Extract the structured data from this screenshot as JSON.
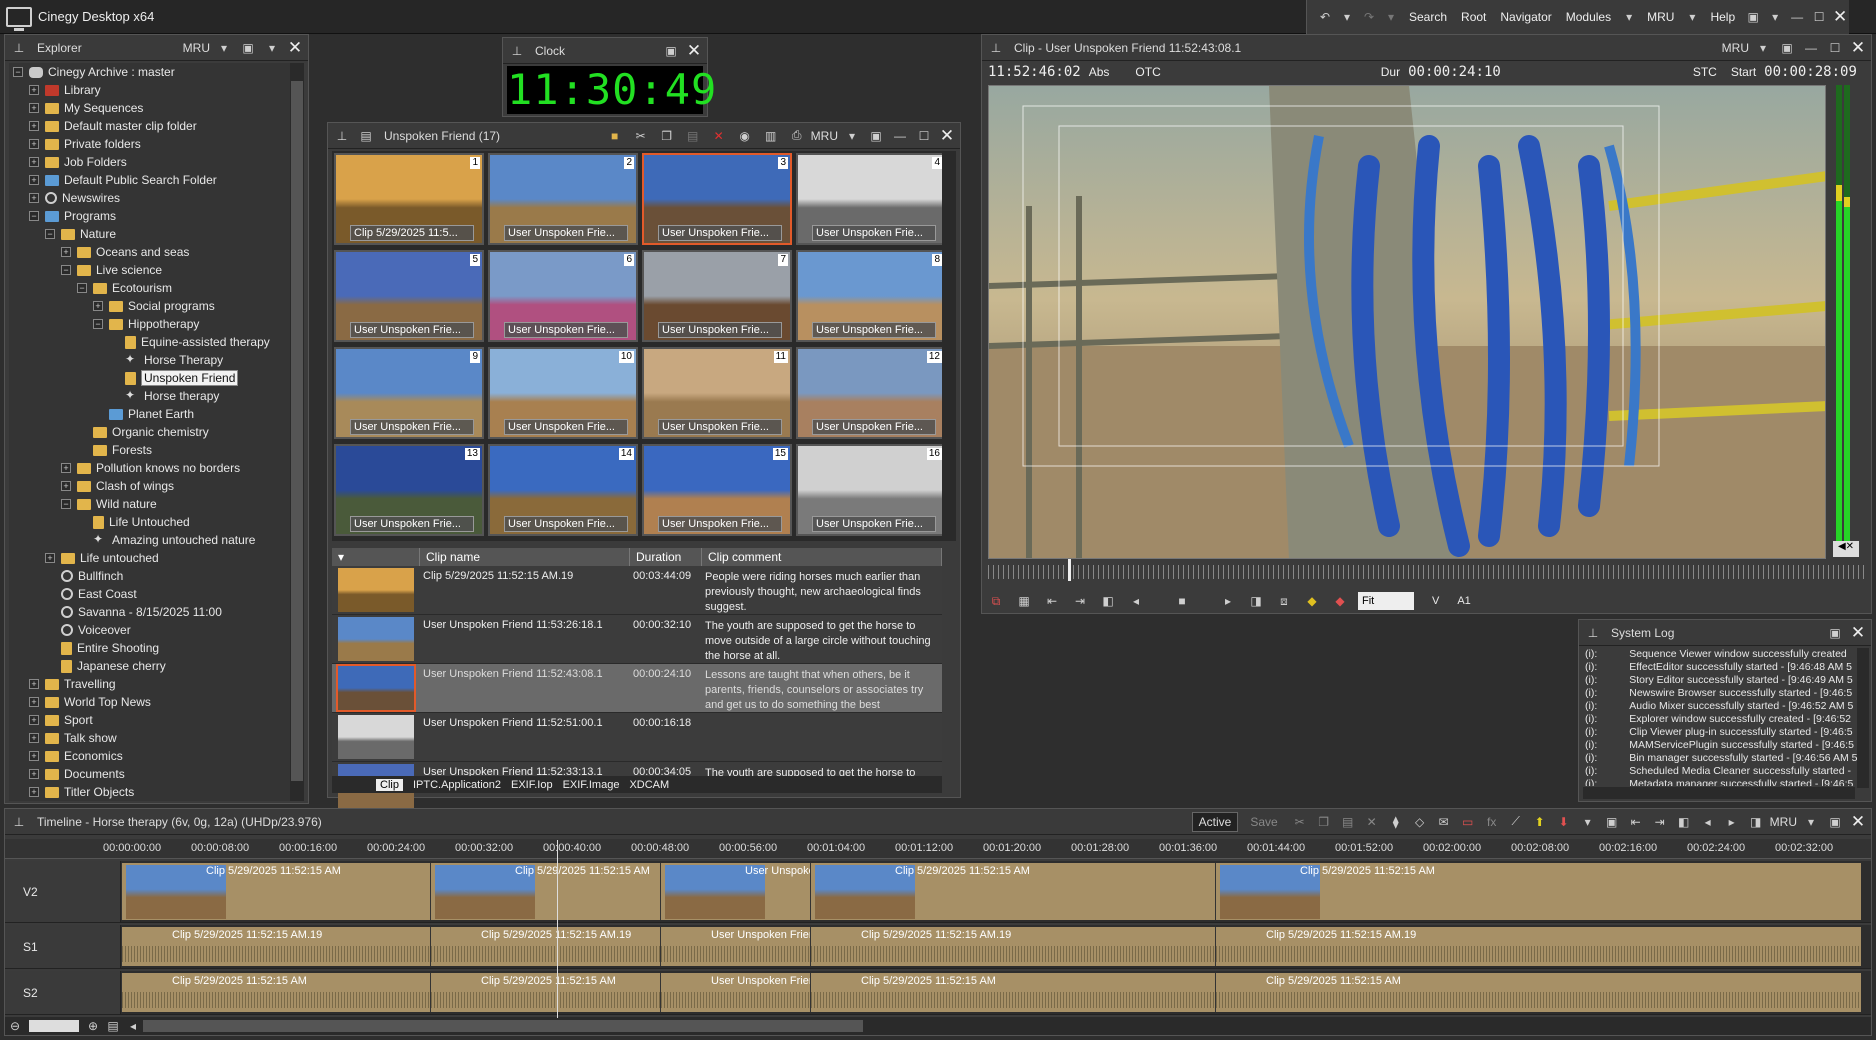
{
  "app": {
    "title": "Cinegy Desktop x64"
  },
  "menu": {
    "items": [
      "Search",
      "Root",
      "Navigator",
      "Modules",
      "MRU",
      "Help"
    ]
  },
  "explorer": {
    "title": "Explorer",
    "mru": "MRU",
    "tree": [
      {
        "label": "Cinegy Archive : master",
        "indent": 0,
        "pm": "-",
        "icon": "db"
      },
      {
        "label": "Library",
        "indent": 1,
        "pm": "+",
        "icon": "red"
      },
      {
        "label": "My Sequences",
        "indent": 1,
        "pm": "+",
        "icon": "folder"
      },
      {
        "label": "Default master clip folder",
        "indent": 1,
        "pm": "+",
        "icon": "folder"
      },
      {
        "label": "Private folders",
        "indent": 1,
        "pm": "+",
        "icon": "folder"
      },
      {
        "label": "Job Folders",
        "indent": 1,
        "pm": "+",
        "icon": "folder"
      },
      {
        "label": "Default Public Search Folder",
        "indent": 1,
        "pm": "+",
        "icon": "blue"
      },
      {
        "label": "Newswires",
        "indent": 1,
        "pm": "+",
        "icon": "glb"
      },
      {
        "label": "Programs",
        "indent": 1,
        "pm": "-",
        "icon": "blue"
      },
      {
        "label": "Nature",
        "indent": 2,
        "pm": "-",
        "icon": "folder"
      },
      {
        "label": "Oceans and seas",
        "indent": 3,
        "pm": "+",
        "icon": "folder"
      },
      {
        "label": "Live science",
        "indent": 3,
        "pm": "-",
        "icon": "folder"
      },
      {
        "label": "Ecotourism",
        "indent": 4,
        "pm": "-",
        "icon": "folder"
      },
      {
        "label": "Social programs",
        "indent": 5,
        "pm": "+",
        "icon": "folder"
      },
      {
        "label": "Hippotherapy",
        "indent": 5,
        "pm": "-",
        "icon": "folder"
      },
      {
        "label": "Equine-assisted therapy",
        "indent": 6,
        "pm": "",
        "icon": "doc"
      },
      {
        "label": "Horse Therapy",
        "indent": 6,
        "pm": "",
        "icon": "star"
      },
      {
        "label": "Unspoken Friend",
        "indent": 6,
        "pm": "",
        "icon": "doc",
        "selected": true
      },
      {
        "label": "Horse therapy",
        "indent": 6,
        "pm": "",
        "icon": "star"
      },
      {
        "label": "Planet Earth",
        "indent": 5,
        "pm": "",
        "icon": "blue"
      },
      {
        "label": "Organic chemistry",
        "indent": 4,
        "pm": "",
        "icon": "folder"
      },
      {
        "label": "Forests",
        "indent": 4,
        "pm": "",
        "icon": "folder"
      },
      {
        "label": "Pollution knows no borders",
        "indent": 3,
        "pm": "+",
        "icon": "folder"
      },
      {
        "label": "Clash of wings",
        "indent": 3,
        "pm": "+",
        "icon": "folder"
      },
      {
        "label": "Wild nature",
        "indent": 3,
        "pm": "-",
        "icon": "folder"
      },
      {
        "label": "Life Untouched",
        "indent": 4,
        "pm": "",
        "icon": "doc"
      },
      {
        "label": "Amazing untouched nature",
        "indent": 4,
        "pm": "",
        "icon": "star"
      },
      {
        "label": "Life untouched",
        "indent": 2,
        "pm": "+",
        "icon": "folder"
      },
      {
        "label": "Bullfinch",
        "indent": 2,
        "pm": "",
        "icon": "glb"
      },
      {
        "label": "East Coast",
        "indent": 2,
        "pm": "",
        "icon": "glb"
      },
      {
        "label": "Savanna - 8/15/2025 11:00",
        "indent": 2,
        "pm": "",
        "icon": "glb"
      },
      {
        "label": "Voiceover",
        "indent": 2,
        "pm": "",
        "icon": "glb"
      },
      {
        "label": "Entire Shooting",
        "indent": 2,
        "pm": "",
        "icon": "doc"
      },
      {
        "label": "Japanese cherry",
        "indent": 2,
        "pm": "",
        "icon": "doc"
      },
      {
        "label": "Travelling",
        "indent": 1,
        "pm": "+",
        "icon": "folder"
      },
      {
        "label": "World Top News",
        "indent": 1,
        "pm": "+",
        "icon": "folder"
      },
      {
        "label": "Sport",
        "indent": 1,
        "pm": "+",
        "icon": "folder"
      },
      {
        "label": "Talk show",
        "indent": 1,
        "pm": "+",
        "icon": "folder"
      },
      {
        "label": "Economics",
        "indent": 1,
        "pm": "+",
        "icon": "folder"
      },
      {
        "label": "Documents",
        "indent": 1,
        "pm": "+",
        "icon": "folder"
      },
      {
        "label": "Titler Objects",
        "indent": 1,
        "pm": "+",
        "icon": "folder"
      }
    ]
  },
  "clock": {
    "title": "Clock",
    "time": "11:30:49"
  },
  "bin": {
    "title": "Unspoken Friend (17)",
    "mru": "MRU",
    "thumbs": [
      {
        "n": "1",
        "cap": "Clip 5/29/2025 11:5...",
        "sky": "#d9a24a",
        "ground": "#7a5a2a"
      },
      {
        "n": "2",
        "cap": "User Unspoken Frie...",
        "sky": "#5a88c8",
        "ground": "#9a7a4a"
      },
      {
        "n": "3",
        "cap": "User Unspoken Frie...",
        "sky": "#3e6ab8",
        "ground": "#6a5038",
        "selected": true
      },
      {
        "n": "4",
        "cap": "User Unspoken Frie...",
        "sky": "#d8d8d8",
        "ground": "#6a6a6a"
      },
      {
        "n": "5",
        "cap": "User Unspoken Frie...",
        "sky": "#4a6ab8",
        "ground": "#8a6a44"
      },
      {
        "n": "6",
        "cap": "User Unspoken Frie...",
        "sky": "#7a9ac8",
        "ground": "#b05080"
      },
      {
        "n": "7",
        "cap": "User Unspoken Frie...",
        "sky": "#9aa0a8",
        "ground": "#6a4a30"
      },
      {
        "n": "8",
        "cap": "User Unspoken Frie...",
        "sky": "#6a98d0",
        "ground": "#b89060"
      },
      {
        "n": "9",
        "cap": "User Unspoken Frie...",
        "sky": "#5a88c8",
        "ground": "#a88a5a"
      },
      {
        "n": "10",
        "cap": "User Unspoken Frie...",
        "sky": "#8ab0d8",
        "ground": "#a88050"
      },
      {
        "n": "11",
        "cap": "User Unspoken Frie...",
        "sky": "#c8a880",
        "ground": "#9a7a50"
      },
      {
        "n": "12",
        "cap": "User Unspoken Frie...",
        "sky": "#7a98c0",
        "ground": "#a88060"
      },
      {
        "n": "13",
        "cap": "User Unspoken Frie...",
        "sky": "#2a4a98",
        "ground": "#4a5a3a"
      },
      {
        "n": "14",
        "cap": "User Unspoken Frie...",
        "sky": "#3a6ac0",
        "ground": "#8a6a3a"
      },
      {
        "n": "15",
        "cap": "User Unspoken Frie...",
        "sky": "#3a68c0",
        "ground": "#b08050"
      },
      {
        "n": "16",
        "cap": "User Unspoken Frie...",
        "sky": "#d0d0d0",
        "ground": "#7a7a7a"
      }
    ],
    "columns": [
      "Clip name",
      "Duration",
      "Clip comment"
    ],
    "rows": [
      {
        "name": "Clip 5/29/2025 11:52:15 AM.19",
        "dur": "00:03:44:09",
        "comment": "People were riding horses much earlier than previously thought, new archaeological finds suggest.",
        "sky": "#d9a24a",
        "ground": "#7a5a2a"
      },
      {
        "name": "User Unspoken Friend 11:53:26:18.1",
        "dur": "00:00:32:10",
        "comment": "The youth are supposed to get the horse to move outside of a large circle without touching the horse at all.",
        "sky": "#5a88c8",
        "ground": "#9a7a4a"
      },
      {
        "name": "User Unspoken Friend 11:52:43:08.1",
        "dur": "00:00:24:10",
        "comment": "Lessons are taught that when others, be it parents, friends, counselors or associates try and get us to do something the best",
        "sky": "#3e6ab8",
        "ground": "#6a5038",
        "selected": true
      },
      {
        "name": "User Unspoken Friend 11:52:51:00.1",
        "dur": "00:00:16:18",
        "comment": "",
        "sky": "#d8d8d8",
        "ground": "#6a6a6a"
      },
      {
        "name": "User Unspoken Friend 11:52:33:13.1",
        "dur": "00:00:34:05",
        "comment": "The youth are supposed to get the horse to",
        "sky": "#4a6ab8",
        "ground": "#8a6a44"
      }
    ],
    "tabs": [
      "Clip",
      "IPTC.Application2",
      "EXIF.Iop",
      "EXIF.Image",
      "XDCAM"
    ]
  },
  "viewer": {
    "title": "Clip - User Unspoken Friend 11:52:43:08.1",
    "mru": "MRU",
    "tc": "11:52:46:02",
    "abs": "Abs",
    "otc": "OTC",
    "dur_label": "Dur",
    "dur": "00:00:24:10",
    "stc": "STC",
    "start_label": "Start",
    "start": "00:00:28:09",
    "fit": "Fit",
    "v": "V",
    "a1": "A1"
  },
  "syslog": {
    "title": "System Log",
    "lines": [
      "Sequence Viewer window successfully created",
      "EffectEditor successfully started - [9:46:48 AM 5",
      "Story Editor successfully started - [9:46:49 AM 5",
      "Newswire Browser successfully started - [9:46:5",
      "Audio Mixer successfully started - [9:46:52 AM 5",
      "Explorer window successfully created - [9:46:52",
      "Clip Viewer plug-in successfully started - [9:46:5",
      "MAMServicePlugin successfully started - [9:46:5",
      "Bin manager successfully started - [9:46:56 AM 5",
      "Scheduled Media Cleaner successfully started -",
      "Metadata manager successfully started - [9:46:5"
    ]
  },
  "timeline": {
    "title": "Timeline - Horse therapy (6v, 0g, 12a) (UHDp/23.976)",
    "active": "Active",
    "save": "Save",
    "mru": "MRU",
    "ruler": [
      "00:00:00:00",
      "00:00:08:00",
      "00:00:16:00",
      "00:00:24:00",
      "00:00:32:00",
      "00:00:40:00",
      "00:00:48:00",
      "00:00:56:00",
      "00:01:04:00",
      "00:01:12:00",
      "00:01:20:00",
      "00:01:28:00",
      "00:01:36:00",
      "00:01:44:00",
      "00:01:52:00",
      "00:02:00:00",
      "00:02:08:00",
      "00:02:16:00",
      "00:02:24:00",
      "00:02:32:00"
    ],
    "tracks": [
      {
        "id": "V2",
        "clips": [
          {
            "name": "Clip 5/29/2025 11:52:15 AM"
          },
          {
            "name": "Clip 5/29/2025 11:52:15 AM"
          },
          {
            "name": "User Unspoken"
          },
          {
            "name": "Clip 5/29/2025 11:52:15 AM"
          },
          {
            "name": "Clip 5/29/2025 11:52:15 AM"
          }
        ]
      },
      {
        "id": "S1",
        "clips": [
          {
            "name": "Clip 5/29/2025 11:52:15 AM.19"
          },
          {
            "name": "Clip 5/29/2025 11:52:15 AM.19"
          },
          {
            "name": "User Unspoken Frien"
          },
          {
            "name": "Clip 5/29/2025 11:52:15 AM.19"
          },
          {
            "name": "Clip 5/29/2025 11:52:15 AM.19"
          }
        ]
      },
      {
        "id": "S2",
        "clips": [
          {
            "name": "Clip 5/29/2025 11:52:15 AM"
          },
          {
            "name": "Clip 5/29/2025 11:52:15 AM"
          },
          {
            "name": "User Unspoken Frien"
          },
          {
            "name": "Clip 5/29/2025 11:52:15 AM"
          },
          {
            "name": "Clip 5/29/2025 11:52:15 AM"
          }
        ]
      }
    ]
  }
}
